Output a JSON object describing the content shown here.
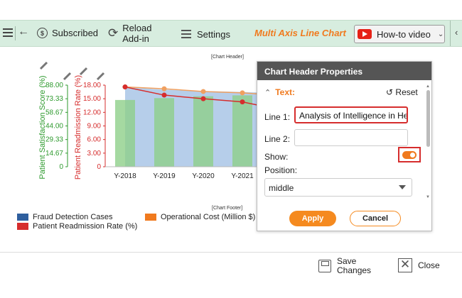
{
  "toolbar": {
    "subscribed_label": "Subscribed",
    "reload_label_line1": "Reload",
    "reload_label_line2": "Add-in",
    "settings_label": "Settings",
    "app_title": "Multi Axis Line Chart",
    "howto_label": "How-to video"
  },
  "chart": {
    "header_placeholder": "[Chart Header]",
    "footer_placeholder": "[Chart Footer]",
    "legend": [
      {
        "label": "Fraud Detection Cases",
        "color": "#2f5f9e"
      },
      {
        "label": "Operational Cost (Million $)",
        "color": "#f07a1e"
      },
      {
        "label": "Patient Readmission Rate (%)",
        "color": "#d62d2d"
      }
    ]
  },
  "chart_data": {
    "type": "line",
    "categories": [
      "Y-2018",
      "Y-2019",
      "Y-2020",
      "Y-2021"
    ],
    "axes": [
      {
        "label": "Patient Satisfaction Score (%)",
        "color": "#2e9a2e",
        "ticks": [
          "88.00",
          "73.33",
          "58.67",
          "44.00",
          "29.33",
          "14.67",
          "0"
        ],
        "ylim": [
          0,
          88
        ]
      },
      {
        "label": "Patient Readmission Rate (%)",
        "color": "#d62d2d",
        "ticks": [
          "18.00",
          "15.00",
          "12.00",
          "9.00",
          "6.00",
          "3.00",
          "0"
        ],
        "ylim": [
          0,
          18
        ]
      }
    ],
    "series": [
      {
        "name": "Patient Satisfaction Score (%)",
        "kind": "bar",
        "color": "#8fcf8a",
        "values": [
          72,
          74,
          76,
          77
        ]
      },
      {
        "name": "Fraud Detection Cases",
        "kind": "area",
        "color": "#a9c6e6",
        "values": [
          17.6,
          17.0,
          16.7,
          16.5
        ]
      },
      {
        "name": "Operational Cost (Million $)",
        "kind": "line",
        "color": "#f0a060",
        "values": [
          17.6,
          17.2,
          16.6,
          16.3
        ]
      },
      {
        "name": "Patient Readmission Rate (%)",
        "kind": "line",
        "color": "#d62d2d",
        "values": [
          17.6,
          15.8,
          15.0,
          14.3
        ]
      }
    ]
  },
  "panel": {
    "title": "Chart Header Properties",
    "section_title": "Text:",
    "reset_label": "Reset",
    "line1_label": "Line 1:",
    "line1_value": "Analysis of Intelligence in Heal",
    "line2_label": "Line 2:",
    "line2_value": "",
    "show_label": "Show:",
    "position_label": "Position:",
    "position_value": "middle",
    "apply_label": "Apply",
    "cancel_label": "Cancel"
  },
  "bottom": {
    "save_line1": "Save",
    "save_line2": "Changes",
    "close_label": "Close"
  }
}
